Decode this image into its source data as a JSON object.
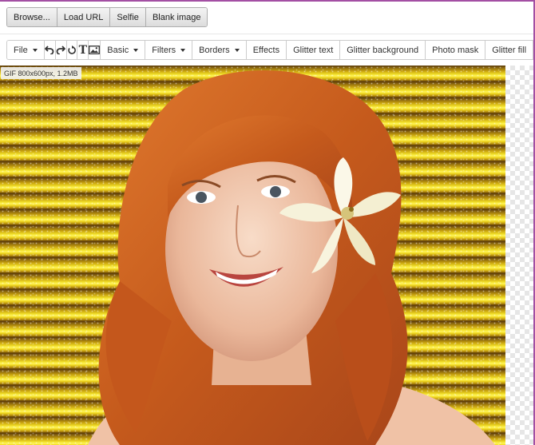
{
  "top_buttons": {
    "browse": "Browse...",
    "load_url": "Load URL",
    "selfie": "Selfie",
    "blank_image": "Blank image"
  },
  "toolbar": {
    "file": "File",
    "basic": "Basic",
    "filters": "Filters",
    "borders": "Borders",
    "effects": "Effects",
    "glitter_text": "Glitter text",
    "glitter_background": "Glitter background",
    "photo_mask": "Photo mask",
    "glitter_fill": "Glitter fill",
    "icons": [
      "undo-icon",
      "redo-icon",
      "rotate-icon",
      "text-icon",
      "image-icon"
    ]
  },
  "canvas": {
    "info_badge": "GIF 800x600px, 1.2MB"
  },
  "colors": {
    "accent_border": "#a34fa3",
    "glitter_gold": "#f2e02a",
    "glitter_dark": "#5a3a0a"
  }
}
